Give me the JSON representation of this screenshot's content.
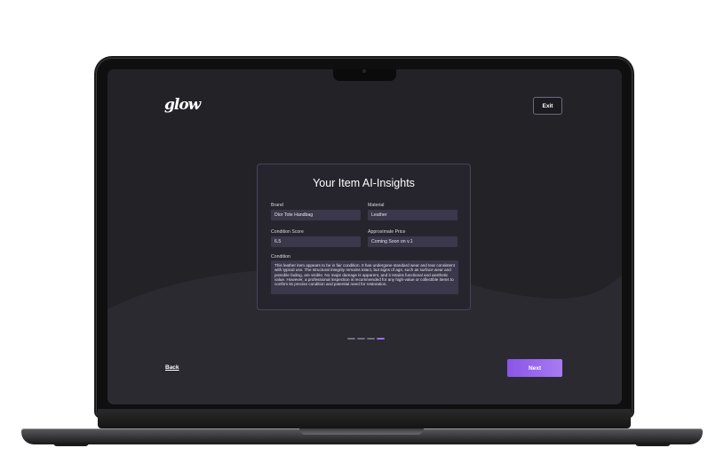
{
  "app": {
    "logo_text": "glow"
  },
  "header": {
    "exit_label": "Exit"
  },
  "card": {
    "title": "Your Item AI-Insights",
    "fields": {
      "brand": {
        "label": "Brand",
        "value": "Dior Tote Handbag"
      },
      "material": {
        "label": "Material",
        "value": "Leather"
      },
      "condition_score": {
        "label": "Condition Score",
        "value": "6.5"
      },
      "approximate_price": {
        "label": "Approximate Price",
        "value": "Coming Soon on v.1"
      },
      "condition": {
        "label": "Condition",
        "value": "This leather item appears to be in fair condition. It has undergone standard wear and tear consistent with typical use. The structural integrity remains intact, but signs of age, such as surface wear and possible fading, are visible. No major damage is apparent, and it retains functional and aesthetic value. However, a professional inspection is recommended for any high-value or collectible items to confirm its precise condition and potential need for restoration."
      }
    }
  },
  "progress": {
    "total_steps": 4,
    "current_step": 4
  },
  "footer": {
    "back_label": "Back",
    "next_label": "Next"
  },
  "colors": {
    "background": "#232227",
    "card": "#26252e",
    "input": "#3a384a",
    "accent": "#9b6cf0"
  }
}
